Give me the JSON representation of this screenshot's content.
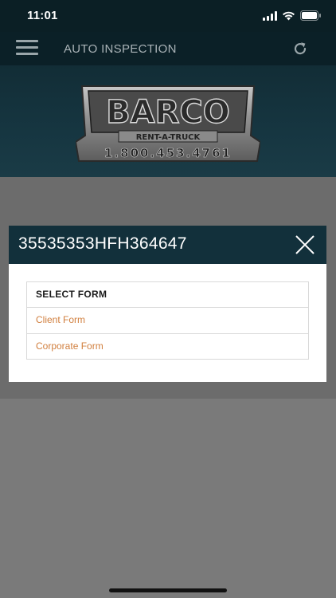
{
  "status_bar": {
    "time": "11:01",
    "icons": [
      "signal-icon",
      "wifi-icon",
      "battery-icon"
    ]
  },
  "header": {
    "title": "AUTO INSPECTION",
    "menu_icon": "hamburger-menu-icon",
    "refresh_icon": "refresh-icon"
  },
  "logo": {
    "brand": "BARCO",
    "tagline": "RENT-A-TRUCK",
    "phone": "1.800.453.4761"
  },
  "modal": {
    "title": "35535353HFH364647",
    "close_icon": "close-icon",
    "list_header": "SELECT FORM",
    "options": [
      {
        "label": "Client Form"
      },
      {
        "label": "Corporate Form"
      }
    ]
  },
  "colors": {
    "header_bg": "#0b2027",
    "modal_header_bg": "#12303b",
    "option_text": "#d17f3e",
    "overlay": "#6c6c6c"
  }
}
